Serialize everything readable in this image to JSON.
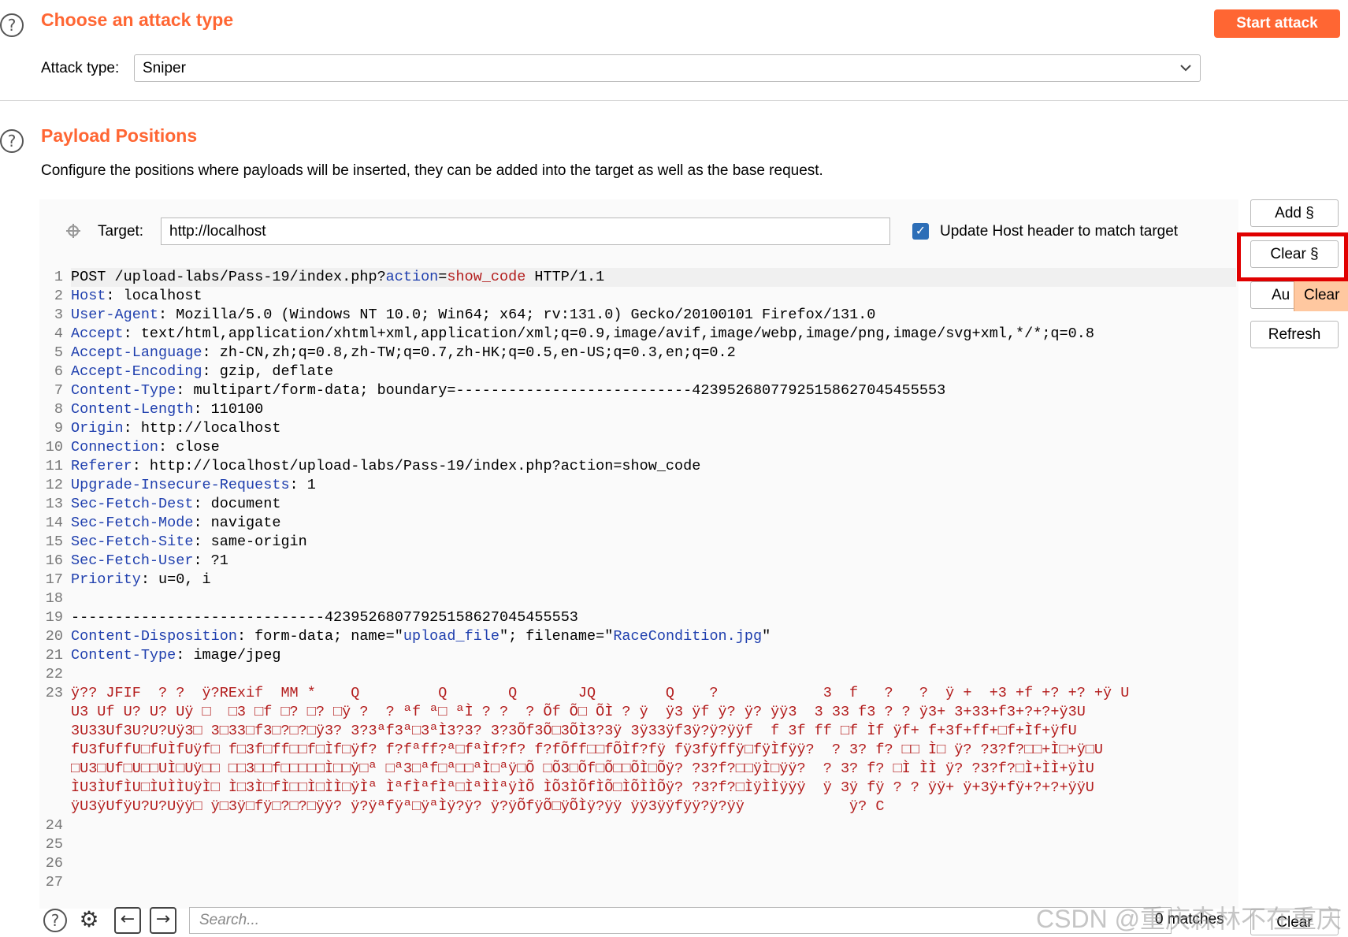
{
  "attack": {
    "title": "Choose an attack type",
    "start_button": "Start attack",
    "type_label": "Attack type:",
    "type_value": "Sniper"
  },
  "positions": {
    "title": "Payload Positions",
    "description": "Configure the positions where payloads will be inserted, they can be added into the target as well as the base request.",
    "target_label": "Target:",
    "target_value": "http://localhost",
    "update_host_label": "Update Host header to match target",
    "update_host_checked": true
  },
  "side_buttons": {
    "add": "Add §",
    "clear": "Clear §",
    "auto": "Au",
    "tooltip": "Clear",
    "refresh": "Refresh"
  },
  "request_lines": [
    {
      "n": "1",
      "parts": [
        [
          "t",
          "POST /upload-labs/Pass-19/index.php?"
        ],
        [
          "b",
          "action"
        ],
        [
          "t",
          "="
        ],
        [
          "r",
          "show_code"
        ],
        [
          "t",
          " HTTP/1.1"
        ]
      ]
    },
    {
      "n": "2",
      "parts": [
        [
          "b",
          "Host"
        ],
        [
          "t",
          ": localhost"
        ]
      ]
    },
    {
      "n": "3",
      "parts": [
        [
          "b",
          "User-Agent"
        ],
        [
          "t",
          ": Mozilla/5.0 (Windows NT 10.0; Win64; x64; rv:131.0) Gecko/20100101 Firefox/131.0"
        ]
      ]
    },
    {
      "n": "4",
      "parts": [
        [
          "b",
          "Accept"
        ],
        [
          "t",
          ": text/html,application/xhtml+xml,application/xml;q=0.9,image/avif,image/webp,image/png,image/svg+xml,*/*;q=0.8"
        ]
      ]
    },
    {
      "n": "5",
      "parts": [
        [
          "b",
          "Accept-Language"
        ],
        [
          "t",
          ": zh-CN,zh;q=0.8,zh-TW;q=0.7,zh-HK;q=0.5,en-US;q=0.3,en;q=0.2"
        ]
      ]
    },
    {
      "n": "6",
      "parts": [
        [
          "b",
          "Accept-Encoding"
        ],
        [
          "t",
          ": gzip, deflate"
        ]
      ]
    },
    {
      "n": "7",
      "parts": [
        [
          "b",
          "Content-Type"
        ],
        [
          "t",
          ": multipart/form-data; boundary=---------------------------42395268077925158627045455553"
        ]
      ]
    },
    {
      "n": "8",
      "parts": [
        [
          "b",
          "Content-Length"
        ],
        [
          "t",
          ": 110100"
        ]
      ]
    },
    {
      "n": "9",
      "parts": [
        [
          "b",
          "Origin"
        ],
        [
          "t",
          ": http://localhost"
        ]
      ]
    },
    {
      "n": "10",
      "parts": [
        [
          "b",
          "Connection"
        ],
        [
          "t",
          ": close"
        ]
      ]
    },
    {
      "n": "11",
      "parts": [
        [
          "b",
          "Referer"
        ],
        [
          "t",
          ": http://localhost/upload-labs/Pass-19/index.php?action=show_code"
        ]
      ]
    },
    {
      "n": "12",
      "parts": [
        [
          "b",
          "Upgrade-Insecure-Requests"
        ],
        [
          "t",
          ": 1"
        ]
      ]
    },
    {
      "n": "13",
      "parts": [
        [
          "b",
          "Sec-Fetch-Dest"
        ],
        [
          "t",
          ": document"
        ]
      ]
    },
    {
      "n": "14",
      "parts": [
        [
          "b",
          "Sec-Fetch-Mode"
        ],
        [
          "t",
          ": navigate"
        ]
      ]
    },
    {
      "n": "15",
      "parts": [
        [
          "b",
          "Sec-Fetch-Site"
        ],
        [
          "t",
          ": same-origin"
        ]
      ]
    },
    {
      "n": "16",
      "parts": [
        [
          "b",
          "Sec-Fetch-User"
        ],
        [
          "t",
          ": ?1"
        ]
      ]
    },
    {
      "n": "17",
      "parts": [
        [
          "b",
          "Priority"
        ],
        [
          "t",
          ": u=0, i"
        ]
      ]
    },
    {
      "n": "18",
      "parts": []
    },
    {
      "n": "19",
      "parts": [
        [
          "t",
          "-----------------------------42395268077925158627045455553"
        ]
      ]
    },
    {
      "n": "20",
      "parts": [
        [
          "b",
          "Content-Disposition"
        ],
        [
          "t",
          ": form-data; name=\""
        ],
        [
          "b",
          "upload_file"
        ],
        [
          "t",
          "\"; filename=\""
        ],
        [
          "b",
          "RaceCondition.jpg"
        ],
        [
          "t",
          "\""
        ]
      ]
    },
    {
      "n": "21",
      "parts": [
        [
          "b",
          "Content-Type"
        ],
        [
          "t",
          ": image/jpeg"
        ]
      ]
    },
    {
      "n": "22",
      "parts": []
    },
    {
      "n": "23",
      "parts": [
        [
          "r",
          "ÿ?? JFIF  ? ?  ÿ?RExif  MM *    Q         Q       Q       JQ        Q    ?            3  f   ?   ?  ÿ +  +3 +f +? +? +ÿ U"
        ]
      ]
    },
    {
      "n": "",
      "parts": [
        [
          "r",
          "U3 Uf U? U? Uÿ □  □3 □f □? □? □ÿ ?  ? ªf ª□ ªÌ ? ?  ? Õf Õ□ ÕÌ ? ÿ  ÿ3 ÿf ÿ? ÿ? ÿÿ3  3 33 f3 ? ? ÿ3+ 3+33+f3+?+?+ÿ3U"
        ]
      ]
    },
    {
      "n": "",
      "parts": [
        [
          "r",
          "3U33Uf3U?U?Uÿ3□ 3□33□f3□?□?□ÿ3? 3?3ªf3ª□3ªÌ3?3? 3?3Õf3Õ□3ÕÌ3?3ÿ 3ÿ33ÿf3ÿ?ÿ?ÿÿf  f 3f ff □f Ìf ÿf+ f+3f+ff+□f+Ìf+ÿfU"
        ]
      ]
    },
    {
      "n": "",
      "parts": [
        [
          "r",
          "fU3fUffU□fUÌfUÿf□ f□3f□ff□□f□Ìf□ÿf? f?fªff?ª□fªÌf?f? f?fÕff□□fÕÌf?fÿ fÿ3fÿffÿ□fÿÌfÿÿ?  ? 3? f? □□ Ì□ ÿ? ?3?f?□□+Ì□+ÿ□U"
        ]
      ]
    },
    {
      "n": "",
      "parts": [
        [
          "r",
          "□U3□Uf□U□□UÌ□Uÿ□□ □□3□□f□□□□□Ì□□ÿ□ª □ª3□ªf□ª□□ªÌ□ªÿ□Õ □Õ3□Õf□Õ□□ÕÌ□Õÿ? ?3?f?□□ÿÌ□ÿÿ?  ? 3? f? □Ì ÌÌ ÿ? ?3?f?□Ì+ÌÌ+ÿÌU"
        ]
      ]
    },
    {
      "n": "",
      "parts": [
        [
          "r",
          "ÌU3ÌUfÌU□ÌUÌÌUÿÌ□ Ì□3Ì□fÌ□□Ì□ÌÌ□ÿÌª ÌªfÌªfÌª□ÌªÌÌªÿÌÕ ÌÕ3ÌÕfÌÕ□ÌÕÌÌÕÿ? ?3?f?□ÌÿÌÌÿÿÿ  ÿ 3ÿ fÿ ? ? ÿÿ+ ÿ+3ÿ+fÿ+?+?+ÿÿU"
        ]
      ]
    },
    {
      "n": "",
      "parts": [
        [
          "r",
          "ÿU3ÿUfÿU?U?Uÿÿ□ ÿ□3ÿ□fÿ□?□?□ÿÿ? ÿ?ÿªfÿª□ÿªÌÿ?ÿ? ÿ?ÿÕfÿÕ□ÿÕÌÿ?ÿÿ ÿÿ3ÿÿfÿÿ?ÿ?ÿÿ            ÿ? C"
        ]
      ]
    },
    {
      "n": "24",
      "parts": []
    },
    {
      "n": "25",
      "parts": []
    },
    {
      "n": "26",
      "parts": []
    },
    {
      "n": "27",
      "parts": []
    }
  ],
  "bottom": {
    "search_placeholder": "Search...",
    "matches": "0 matches",
    "clear": "Clear"
  },
  "watermark": "CSDN @重庆森林不在重庆",
  "colors": {
    "accent": "#ff6633",
    "header_key": "#1f3fae",
    "payload": "#b31c1c",
    "highlight_box": "#e00000"
  }
}
